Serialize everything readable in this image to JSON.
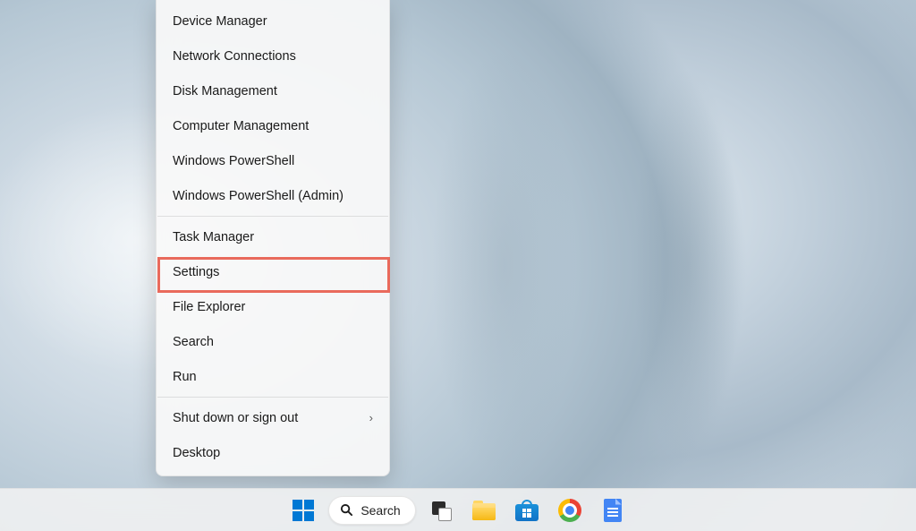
{
  "context_menu": {
    "groups": [
      [
        {
          "id": "device-manager",
          "label": "Device Manager",
          "submenu": false
        },
        {
          "id": "network-connections",
          "label": "Network Connections",
          "submenu": false
        },
        {
          "id": "disk-management",
          "label": "Disk Management",
          "submenu": false
        },
        {
          "id": "computer-management",
          "label": "Computer Management",
          "submenu": false
        },
        {
          "id": "windows-powershell",
          "label": "Windows PowerShell",
          "submenu": false
        },
        {
          "id": "windows-powershell-admin",
          "label": "Windows PowerShell (Admin)",
          "submenu": false
        }
      ],
      [
        {
          "id": "task-manager",
          "label": "Task Manager",
          "submenu": false
        },
        {
          "id": "settings",
          "label": "Settings",
          "submenu": false,
          "highlighted": true
        },
        {
          "id": "file-explorer",
          "label": "File Explorer",
          "submenu": false
        },
        {
          "id": "search",
          "label": "Search",
          "submenu": false
        },
        {
          "id": "run",
          "label": "Run",
          "submenu": false
        }
      ],
      [
        {
          "id": "shut-down-sign-out",
          "label": "Shut down or sign out",
          "submenu": true
        },
        {
          "id": "desktop",
          "label": "Desktop",
          "submenu": false
        }
      ]
    ]
  },
  "taskbar": {
    "search_label": "Search",
    "items": [
      {
        "id": "start",
        "name": "start-button"
      },
      {
        "id": "search",
        "name": "search-button"
      },
      {
        "id": "task-view",
        "name": "task-view-button"
      },
      {
        "id": "file-explorer",
        "name": "file-explorer-button"
      },
      {
        "id": "microsoft-store",
        "name": "microsoft-store-button"
      },
      {
        "id": "chrome",
        "name": "chrome-button"
      },
      {
        "id": "docs",
        "name": "google-docs-button"
      }
    ]
  },
  "highlight": {
    "target": "settings",
    "color": "#e96a5c"
  }
}
